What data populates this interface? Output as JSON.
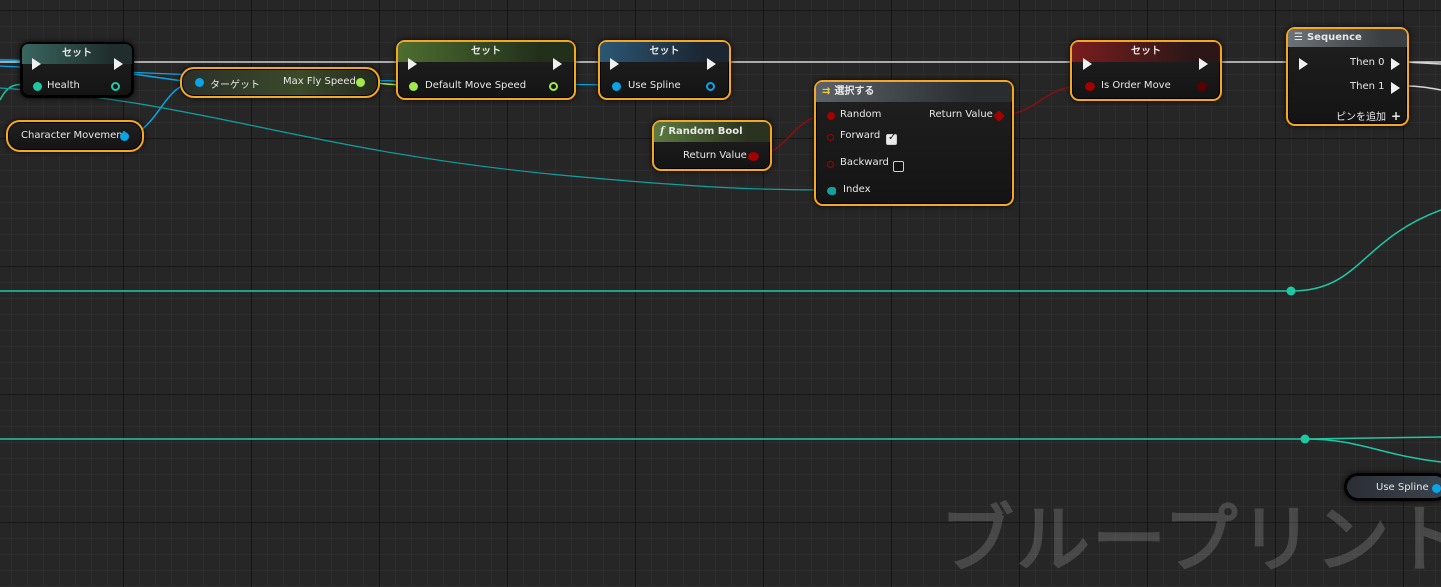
{
  "watermark": "ブループリント",
  "nodes": {
    "set_health": {
      "title": "セット",
      "pin": "Health"
    },
    "character_movement": {
      "label": "Character Movement"
    },
    "max_fly_speed": {
      "left": "ターゲット",
      "right": "Max Fly Speed"
    },
    "set_default_move_speed": {
      "title": "セット",
      "pin": "Default Move Speed"
    },
    "set_use_spline": {
      "title": "セット",
      "pin": "Use Spline"
    },
    "random_bool": {
      "title": "Random Bool",
      "output": "Return Value"
    },
    "select": {
      "title": "選択する",
      "pins": {
        "random": "Random",
        "forward": "Forward",
        "backward": "Backward",
        "index": "Index"
      },
      "output": "Return Value",
      "forward_checked": true,
      "backward_checked": false
    },
    "set_is_order_move": {
      "title": "セット",
      "pin": "Is Order Move"
    },
    "sequence": {
      "title": "Sequence",
      "then0": "Then 0",
      "then1": "Then 1",
      "add_pin": "ピンを追加"
    },
    "use_spline_getter": {
      "label": "Use Spline"
    }
  },
  "colors": {
    "exec": "#e0e0e0",
    "float": "#a1e84a",
    "object": "#0aa5e6",
    "bool": "#a30000",
    "int": "#1ec8a5",
    "struct": "#10a0a0",
    "selection": "#f5a623"
  }
}
